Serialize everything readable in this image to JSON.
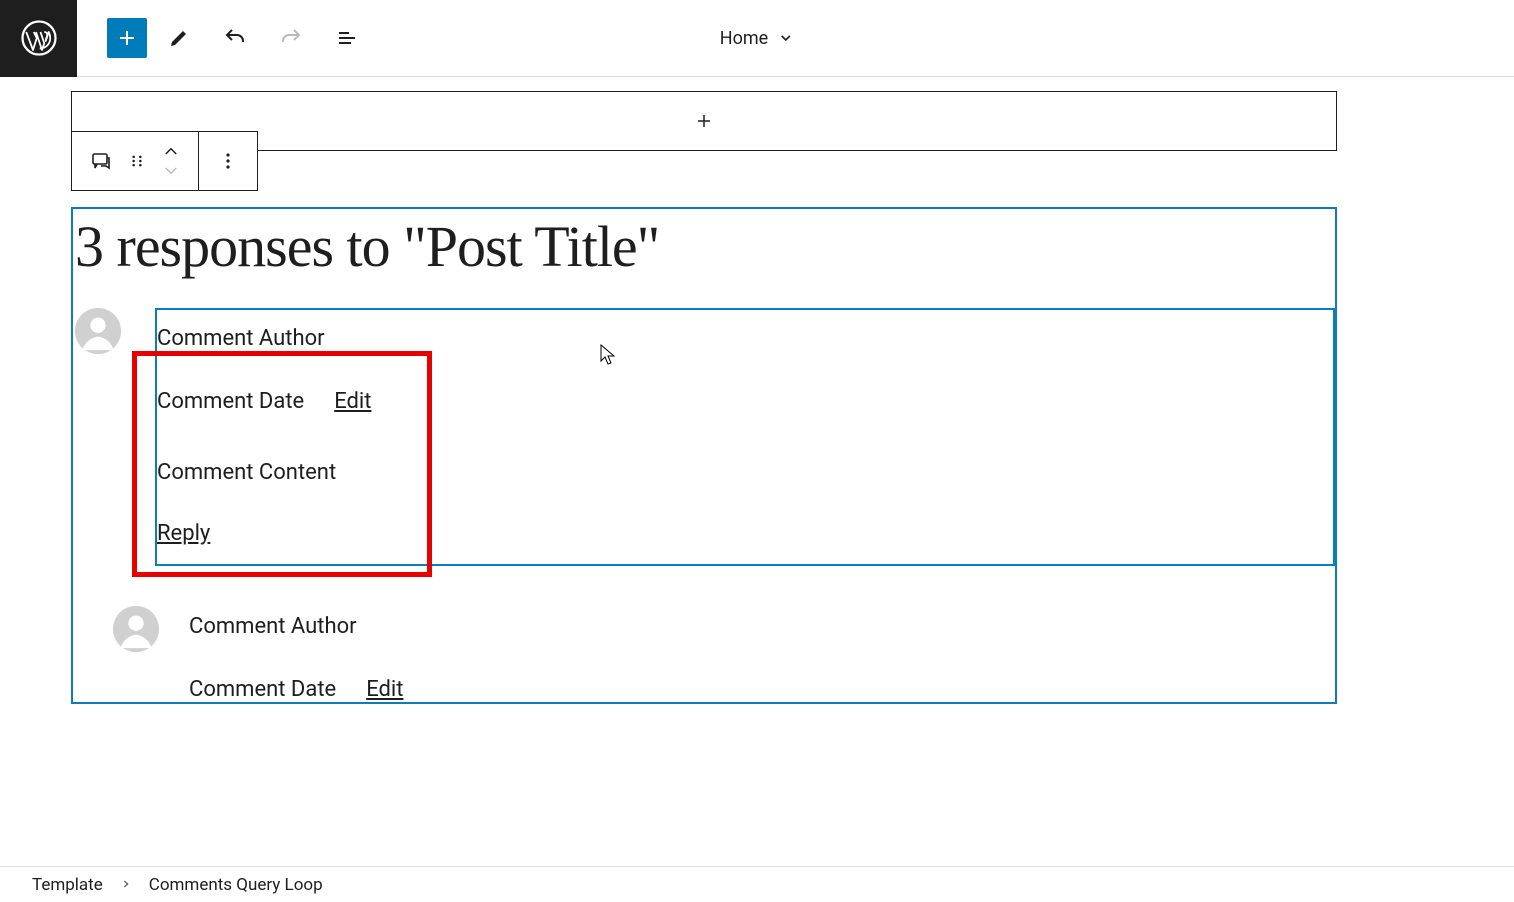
{
  "toolbar": {
    "page_label": "Home"
  },
  "comments_block": {
    "title": "3 responses to \"Post Title\""
  },
  "comment_template": {
    "author_label": "Comment Author",
    "date_label": "Comment Date",
    "edit_label": "Edit",
    "content_label": "Comment Content",
    "reply_label": "Reply"
  },
  "breadcrumb": {
    "root": "Template",
    "current": "Comments Query Loop"
  }
}
